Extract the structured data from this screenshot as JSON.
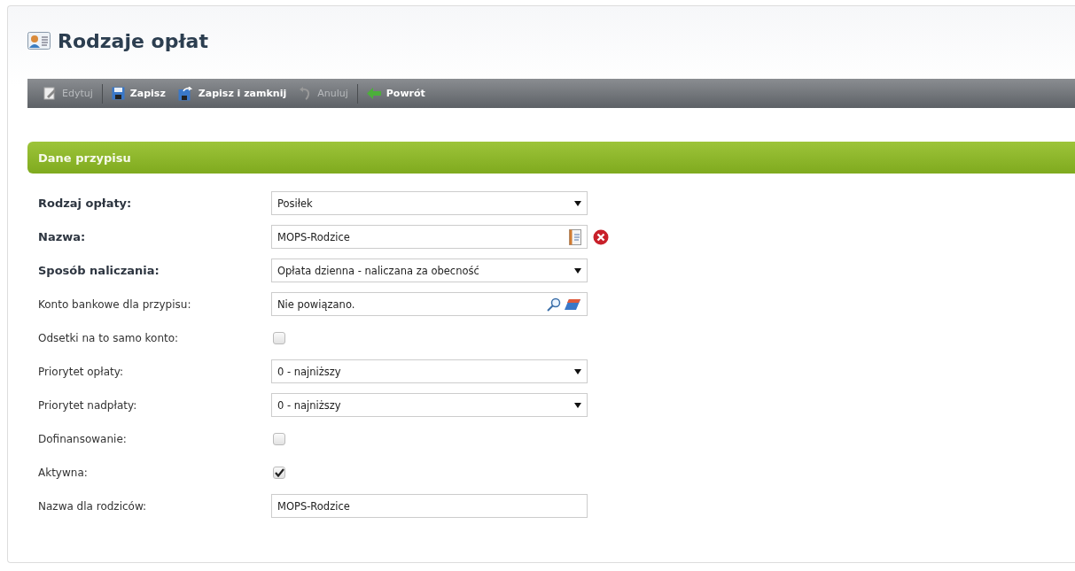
{
  "page": {
    "title": "Rodzaje opłat"
  },
  "toolbar": [
    {
      "kind": "edit",
      "label": "Edytuj",
      "disabled": true,
      "separator_after": true
    },
    {
      "kind": "save",
      "label": "Zapisz",
      "disabled": false,
      "separator_after": false
    },
    {
      "kind": "save_close",
      "label": "Zapisz i zamknij",
      "disabled": false,
      "separator_after": false
    },
    {
      "kind": "undo",
      "label": "Anuluj",
      "disabled": true,
      "separator_after": true
    },
    {
      "kind": "back",
      "label": "Powrót",
      "disabled": false,
      "separator_after": false
    }
  ],
  "section": {
    "title": "Dane przypisu"
  },
  "fields": [
    {
      "kind": "select",
      "label": "Rodzaj opłaty:",
      "required": true,
      "value": "Posiłek"
    },
    {
      "kind": "text_book",
      "label": "Nazwa:",
      "required": true,
      "value": "MOPS-Rodzice"
    },
    {
      "kind": "select",
      "label": "Sposób naliczania:",
      "required": true,
      "value": "Opłata dzienna - naliczana za obecność"
    },
    {
      "kind": "lookup",
      "label": "Konto bankowe dla przypisu:",
      "required": false,
      "value": "Nie powiązano."
    },
    {
      "kind": "checkbox",
      "label": "Odsetki na to samo konto:",
      "required": false,
      "checked": false
    },
    {
      "kind": "select",
      "label": "Priorytet opłaty:",
      "required": false,
      "value": "0 - najniższy"
    },
    {
      "kind": "select",
      "label": "Priorytet nadpłaty:",
      "required": false,
      "value": "0 - najniższy"
    },
    {
      "kind": "checkbox",
      "label": "Dofinansowanie:",
      "required": false,
      "checked": false
    },
    {
      "kind": "checkbox",
      "label": "Aktywna:",
      "required": false,
      "checked": true
    },
    {
      "kind": "text",
      "label": "Nazwa dla rodziców:",
      "required": false,
      "value": "MOPS-Rodzice"
    }
  ]
}
